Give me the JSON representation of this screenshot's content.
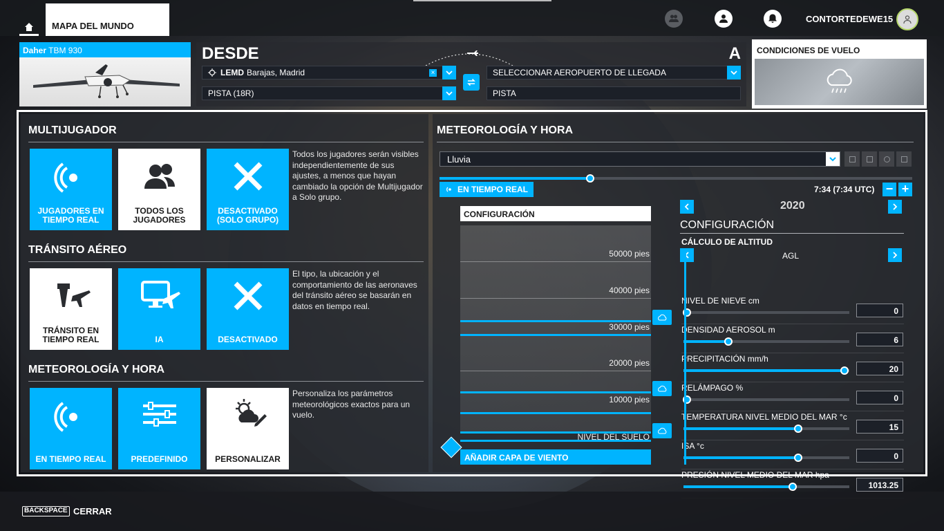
{
  "topbar": {
    "world_map_tab": "MAPA DEL MUNDO",
    "username": "CONTORTEDEWE15",
    "icons": [
      "home-icon",
      "friends-icon",
      "profile-icon",
      "notifications-icon",
      "avatar-icon"
    ]
  },
  "aircraft": {
    "brand": "Daher",
    "model": "TBM 930"
  },
  "route": {
    "from_label": "DESDE",
    "to_label": "A",
    "departure_code": "LEMD",
    "departure_name": "Barajas, Madrid",
    "departure_runway": "PISTA (18R)",
    "arrival_placeholder": "SELECCIONAR AEROPUERTO DE LLEGADA",
    "arrival_runway": "PISTA"
  },
  "conditions": {
    "title": "CONDICIONES DE VUELO",
    "icon": "rain-cloud-icon"
  },
  "left": {
    "multiplayer": {
      "title": "MULTIJUGADOR",
      "tiles": [
        "JUGADORES EN TIEMPO REAL",
        "TODOS LOS JUGADORES",
        "DESACTIVADO (SOLO GRUPO)"
      ],
      "desc": "Todos los jugadores serán visibles independientemente de sus ajustes, a menos que hayan cambiado la opción de Multijugador a Solo grupo."
    },
    "traffic": {
      "title": "TRÁNSITO AÉREO",
      "tiles": [
        "TRÁNSITO EN TIEMPO REAL",
        "IA",
        "DESACTIVADO"
      ],
      "desc": "El tipo, la ubicación y el comportamiento de las aeronaves del tránsito aéreo se basarán en datos en tiempo real."
    },
    "weather": {
      "title": "METEOROLOGÍA Y HORA",
      "tiles": [
        "EN TIEMPO REAL",
        "PREDEFINIDO",
        "PERSONALIZAR"
      ],
      "desc": "Personaliza los parámetros meteorológicos exactos para un vuelo."
    }
  },
  "right": {
    "title": "METEOROLOGÍA Y HORA",
    "preset": "Lluvia",
    "time_of_day_fraction": 0.318,
    "realtime_button": "EN TIEMPO REAL",
    "time": "7:34 (7:34 UTC)",
    "minus": "−",
    "plus": "+",
    "layers": {
      "header": "CONFIGURACIÓN",
      "altitudes": [
        "50000 pies",
        "40000 pies",
        "30000 pies",
        "20000 pies",
        "10000 pies",
        "NIVEL DEL SUELO"
      ],
      "add_wind": "AÑADIR CAPA DE VIENTO"
    },
    "settings": {
      "year": "2020",
      "title": "CONFIGURACIÓN",
      "altitude_calc_label": "CÁLCULO DE ALTITUD",
      "altitude_calc_value": "AGL",
      "params": [
        {
          "name": "NIVEL DE NIEVE cm",
          "value": "0",
          "fraction": 0.02
        },
        {
          "name": "DENSIDAD AEROSOL m",
          "value": "6",
          "fraction": 0.27
        },
        {
          "name": "PRECIPITACIÓN mm/h",
          "value": "20",
          "fraction": 0.97
        },
        {
          "name": "RELÁMPAGO %",
          "value": "0",
          "fraction": 0.02
        },
        {
          "name": "TEMPERATURA NIVEL MEDIO DEL MAR °c",
          "value": "15",
          "fraction": 0.69
        },
        {
          "name": "ISA °c",
          "value": "0",
          "fraction": 0.69
        },
        {
          "name": "PRESIÓN NIVEL MEDIO DEL MAR hpa",
          "value": "1013.25",
          "fraction": 0.66
        }
      ]
    }
  },
  "bottom": {
    "key": "BACKSPACE",
    "label": "CERRAR"
  },
  "colors": {
    "accent": "#00b4ff",
    "panel": "#282a2f",
    "white": "#ffffff"
  }
}
